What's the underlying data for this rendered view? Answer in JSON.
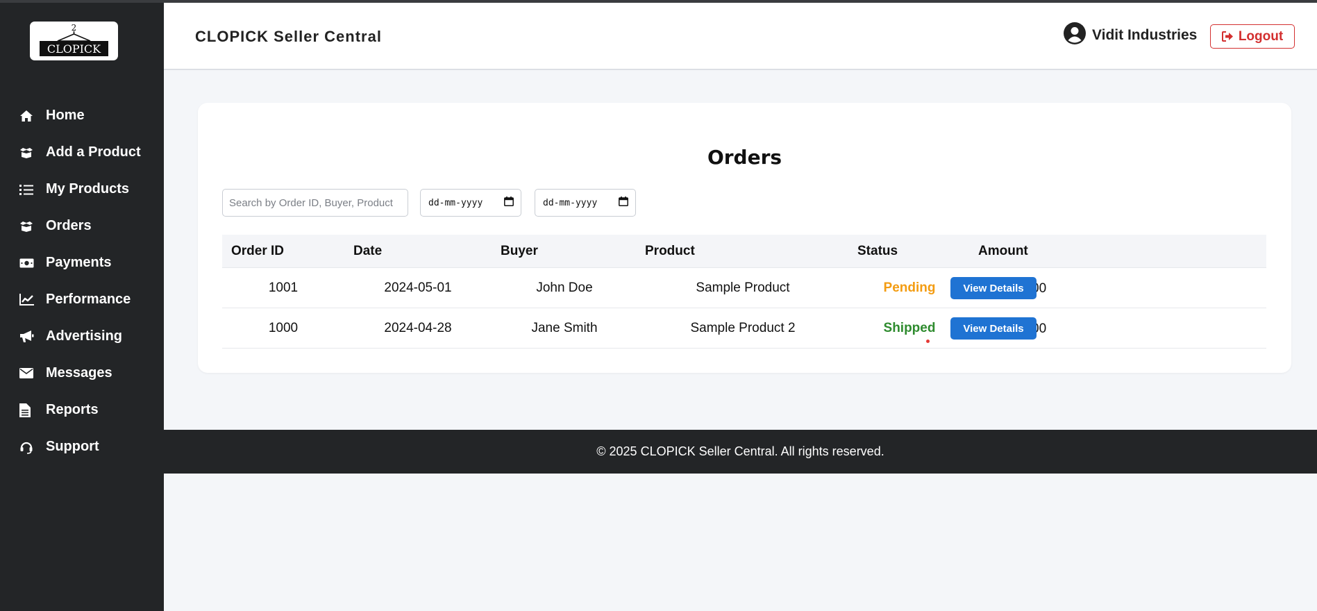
{
  "sidebar": {
    "logo_text": "CLOPICK",
    "items": [
      {
        "label": "Home",
        "icon": "home-icon"
      },
      {
        "label": "Add a Product",
        "icon": "box-open-icon"
      },
      {
        "label": "My Products",
        "icon": "list-icon"
      },
      {
        "label": "Orders",
        "icon": "box-open-icon"
      },
      {
        "label": "Payments",
        "icon": "money-bill-icon"
      },
      {
        "label": "Performance",
        "icon": "chart-line-icon"
      },
      {
        "label": "Advertising",
        "icon": "megaphone-icon"
      },
      {
        "label": "Messages",
        "icon": "envelope-icon"
      },
      {
        "label": "Reports",
        "icon": "file-icon"
      },
      {
        "label": "Support",
        "icon": "headset-icon"
      }
    ]
  },
  "header": {
    "title": "CLOPICK Seller Central",
    "user_name": "Vidit Industries",
    "logout_label": "Logout"
  },
  "orders": {
    "title": "Orders",
    "search_placeholder": "Search by Order ID, Buyer, Product",
    "date_from_placeholder": "dd-mm-yyyy",
    "date_to_placeholder": "dd-mm-yyyy",
    "columns": [
      "Order ID",
      "Date",
      "Buyer",
      "Product",
      "Status",
      "Amount"
    ],
    "rows": [
      {
        "id": "1001",
        "date": "2024-05-01",
        "buyer": "John Doe",
        "product": "Sample Product",
        "status": "Pending",
        "amount": "₹2500",
        "action": "View Details"
      },
      {
        "id": "1000",
        "date": "2024-04-28",
        "buyer": "Jane Smith",
        "product": "Sample Product 2",
        "status": "Shipped",
        "amount": "₹1200",
        "action": "View Details"
      }
    ]
  },
  "colors": {
    "sidebar_bg": "#232527",
    "pending": "#f39c12",
    "shipped": "#2e8b2e",
    "primary": "#1f73d3",
    "logout": "#d32f2f"
  },
  "footer": {
    "text": "© 2025 CLOPICK Seller Central. All rights reserved."
  }
}
